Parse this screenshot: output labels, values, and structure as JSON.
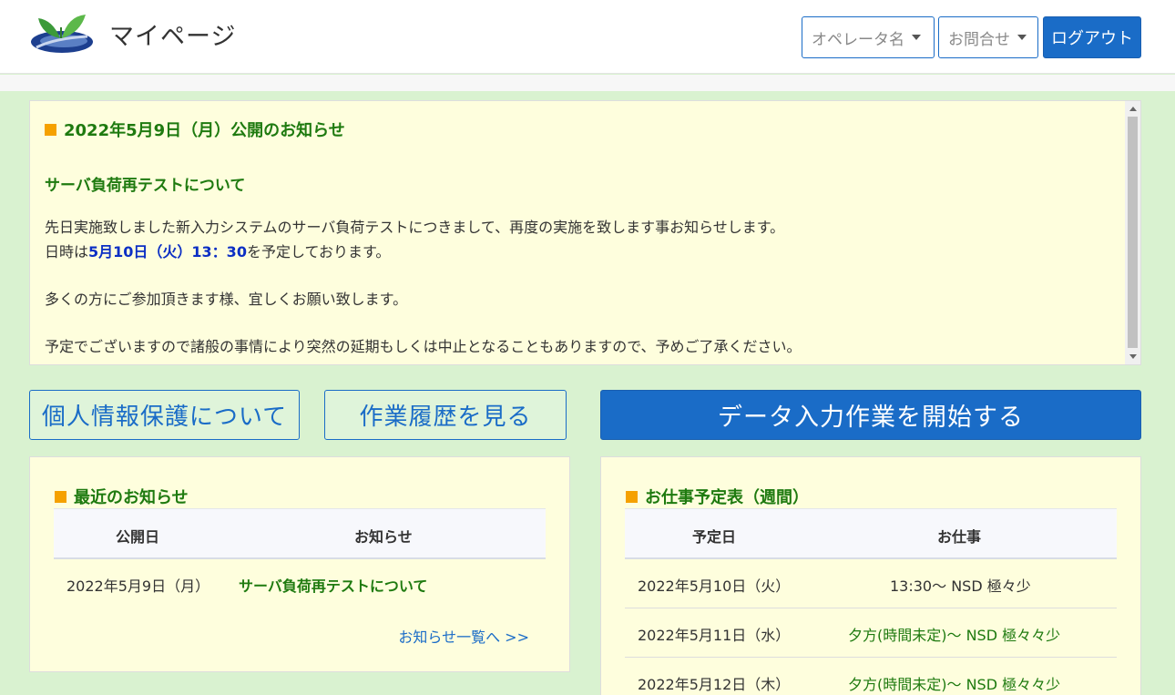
{
  "header": {
    "title": "マイページ",
    "operator_label": "オペレータ名",
    "contact_label": "お問合せ",
    "logout_label": "ログアウト"
  },
  "notice": {
    "title": "2022年5月9日（月）公開のお知らせ",
    "subtitle": "サーバ負荷再テストについて",
    "line1": "先日実施致しました新入力システムのサーバ負荷テストにつきまして、再度の実施を致します事お知らせします。",
    "line2_prefix": "日時は",
    "line2_highlight": "5月10日（火）13：30",
    "line2_suffix": "を予定しております。",
    "line3": "多くの方にご参加頂きます様、宜しくお願い致します。",
    "line4": "予定でございますので諸般の事情により突然の延期もしくは中止となることもありますので、予めご了承ください。"
  },
  "buttons": {
    "privacy": "個人情報保護について",
    "history": "作業履歴を見る",
    "start": "データ入力作業を開始する"
  },
  "recent_news": {
    "title": "最近のお知らせ",
    "headers": [
      "公開日",
      "お知らせ"
    ],
    "rows": [
      {
        "date": "2022年5月9日（月）",
        "text": "サーバ負荷再テストについて"
      }
    ],
    "more_link": "お知らせ一覧へ >>"
  },
  "schedule": {
    "title": "お仕事予定表（週間）",
    "headers": [
      "予定日",
      "お仕事"
    ],
    "rows": [
      {
        "date": "2022年5月10日（火）",
        "job": "13:30〜 NSD 極々少"
      },
      {
        "date": "2022年5月11日（水）",
        "job": "夕方(時間未定)〜 NSD 極々々少"
      },
      {
        "date": "2022年5月12日（木）",
        "job": "夕方(時間未定)〜 NSD 極々々少"
      }
    ]
  },
  "colors": {
    "primary_blue": "#1a6cc7",
    "accent_green": "#1e7a0f",
    "square_orange": "#f5a100",
    "panel_bg": "#fefedd",
    "page_bg": "#d9f2d0"
  }
}
